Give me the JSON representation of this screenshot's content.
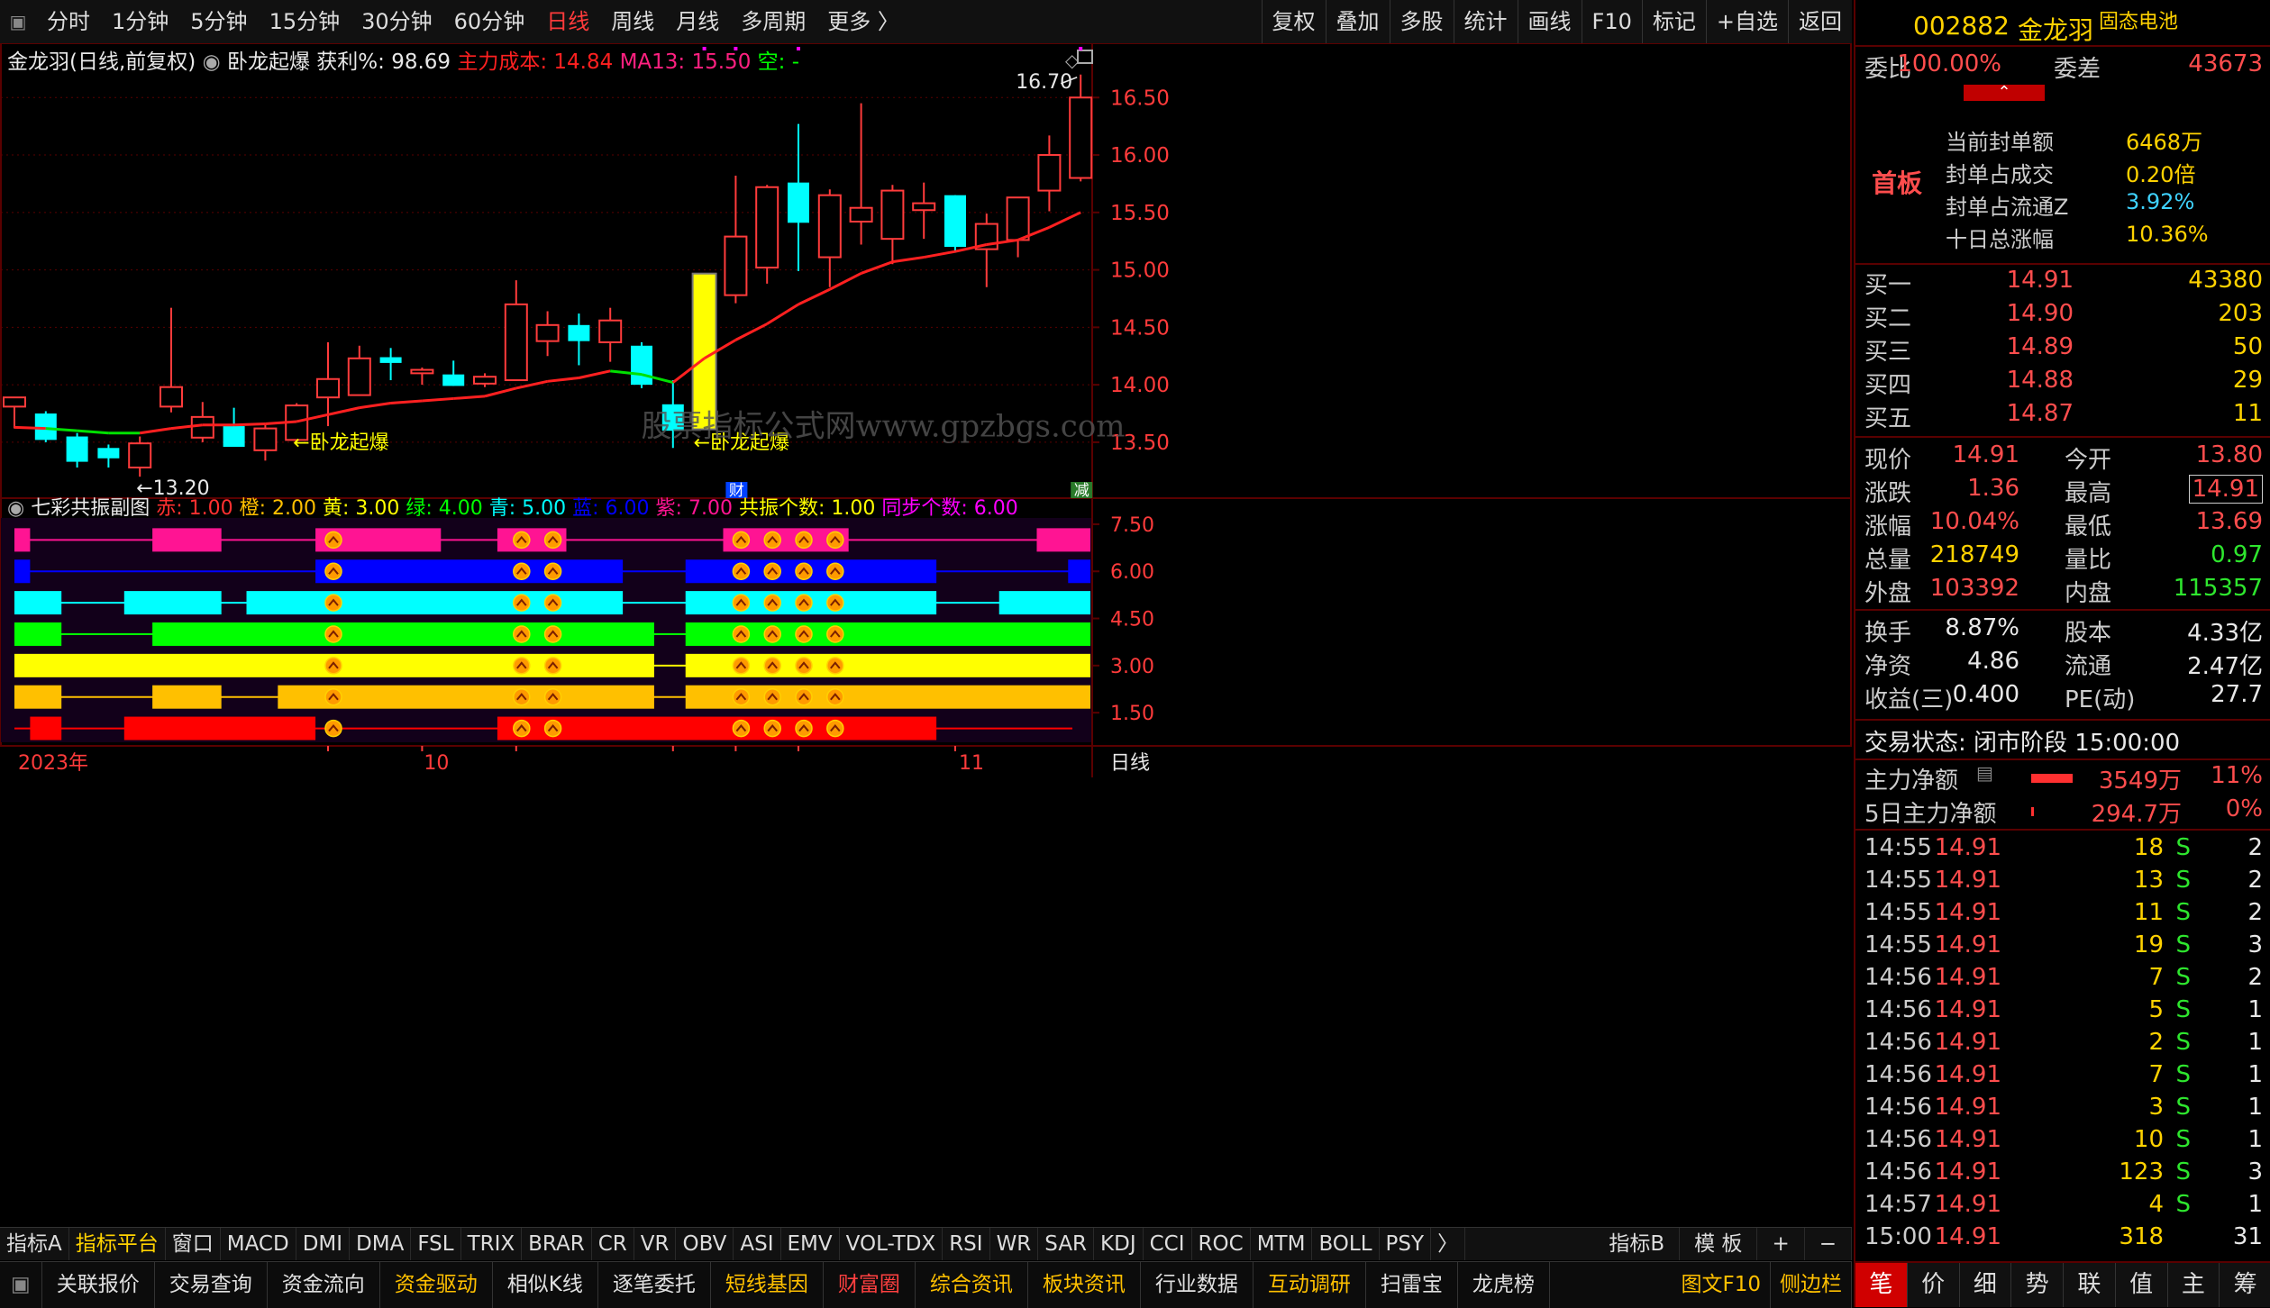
{
  "toolbar": {
    "periods": [
      "分时",
      "1分钟",
      "5分钟",
      "15分钟",
      "30分钟",
      "60分钟",
      "日线",
      "周线",
      "月线",
      "多周期",
      "更多 〉"
    ],
    "active_period": "日线",
    "right": [
      "复权",
      "叠加",
      "多股",
      "统计",
      "画线",
      "F10",
      "标记",
      "+自选",
      "返回"
    ]
  },
  "chart_header": {
    "name": "金龙羽(日线,前复权)",
    "indicator": "卧龙起爆",
    "profit_label": "获利%: 98.69",
    "cost_label": "主力成本: 14.84",
    "ma_label": "MA13: 15.50",
    "kong_label": "空: -"
  },
  "annotations": {
    "high_label": "16.70",
    "low_label": "←13.20",
    "signal1": "←卧龙起爆",
    "signal2": "←卧龙起爆",
    "watermark": "股票指标公式网www.gpzbgs.com",
    "cai_badge": "财",
    "jian_badge": "减"
  },
  "sub_header": {
    "name": "七彩共振副图",
    "items": [
      {
        "text": "赤: 1.00",
        "color": "#ff3030"
      },
      {
        "text": "橙: 2.00",
        "color": "#ffc000"
      },
      {
        "text": "黄: 3.00",
        "color": "#ffff00"
      },
      {
        "text": "绿: 4.00",
        "color": "#00ff00"
      },
      {
        "text": "青: 5.00",
        "color": "#00ffff"
      },
      {
        "text": "蓝: 6.00",
        "color": "#0000ff"
      },
      {
        "text": "紫: 7.00",
        "color": "#ff1493"
      },
      {
        "text": "共振个数: 1.00",
        "color": "#ffff00"
      },
      {
        "text": "同步个数: 6.00",
        "color": "#ff00ff"
      }
    ]
  },
  "time_axis": {
    "year": "2023年",
    "m10": "10",
    "m11": "11",
    "period": "日线"
  },
  "chart_data": [
    {
      "type": "candlestick",
      "title": "金龙羽(日线,前复权)",
      "ylim": [
        13.17,
        16.8
      ],
      "yticks": [
        13.5,
        14.0,
        14.5,
        15.0,
        15.5,
        16.0,
        16.5
      ],
      "ytick_labels": [
        "13.50",
        "14.00",
        "14.50",
        "15.00",
        "15.50",
        "16.00",
        "16.50"
      ],
      "candles": [
        {
          "o": 13.81,
          "h": 13.88,
          "l": 13.62,
          "c": 13.89
        },
        {
          "o": 13.75,
          "h": 13.77,
          "l": 13.5,
          "c": 13.52
        },
        {
          "o": 13.55,
          "h": 13.58,
          "l": 13.28,
          "c": 13.33
        },
        {
          "o": 13.45,
          "h": 13.48,
          "l": 13.28,
          "c": 13.36
        },
        {
          "o": 13.28,
          "h": 13.55,
          "l": 13.2,
          "c": 13.49
        },
        {
          "o": 13.81,
          "h": 14.67,
          "l": 13.76,
          "c": 13.98
        },
        {
          "o": 13.54,
          "h": 13.85,
          "l": 13.5,
          "c": 13.72
        },
        {
          "o": 13.64,
          "h": 13.8,
          "l": 13.47,
          "c": 13.46
        },
        {
          "o": 13.43,
          "h": 13.65,
          "l": 13.34,
          "c": 13.62
        },
        {
          "o": 13.52,
          "h": 13.84,
          "l": 13.5,
          "c": 13.82
        },
        {
          "o": 13.89,
          "h": 14.37,
          "l": 13.64,
          "c": 14.05
        },
        {
          "o": 13.91,
          "h": 14.34,
          "l": 13.91,
          "c": 14.23
        },
        {
          "o": 14.24,
          "h": 14.32,
          "l": 14.04,
          "c": 14.19
        },
        {
          "o": 14.1,
          "h": 14.15,
          "l": 14.0,
          "c": 14.13
        },
        {
          "o": 14.09,
          "h": 14.21,
          "l": 13.99,
          "c": 13.99
        },
        {
          "o": 14.01,
          "h": 14.1,
          "l": 13.98,
          "c": 14.07
        },
        {
          "o": 14.04,
          "h": 14.91,
          "l": 14.04,
          "c": 14.7
        },
        {
          "o": 14.38,
          "h": 14.64,
          "l": 14.25,
          "c": 14.52
        },
        {
          "o": 14.52,
          "h": 14.62,
          "l": 14.17,
          "c": 14.38
        },
        {
          "o": 14.37,
          "h": 14.67,
          "l": 14.2,
          "c": 14.56
        },
        {
          "o": 14.34,
          "h": 14.37,
          "l": 13.97,
          "c": 14.0
        },
        {
          "o": 13.83,
          "h": 14.04,
          "l": 13.45,
          "c": 13.6
        },
        {
          "o": 13.62,
          "h": 14.96,
          "l": 13.62,
          "c": 14.96
        },
        {
          "o": 14.78,
          "h": 15.82,
          "l": 14.71,
          "c": 15.29
        },
        {
          "o": 15.02,
          "h": 15.74,
          "l": 14.88,
          "c": 15.72
        },
        {
          "o": 15.76,
          "h": 16.27,
          "l": 14.99,
          "c": 15.41
        },
        {
          "o": 15.11,
          "h": 15.7,
          "l": 14.85,
          "c": 15.65
        },
        {
          "o": 15.42,
          "h": 16.45,
          "l": 15.22,
          "c": 15.54
        },
        {
          "o": 15.27,
          "h": 15.74,
          "l": 15.05,
          "c": 15.69
        },
        {
          "o": 15.52,
          "h": 15.76,
          "l": 15.27,
          "c": 15.58
        },
        {
          "o": 15.65,
          "h": 15.65,
          "l": 15.15,
          "c": 15.2
        },
        {
          "o": 15.18,
          "h": 15.49,
          "l": 14.85,
          "c": 15.4
        },
        {
          "o": 15.26,
          "h": 15.6,
          "l": 15.11,
          "c": 15.63
        },
        {
          "o": 15.69,
          "h": 16.17,
          "l": 15.51,
          "c": 16.0
        },
        {
          "o": 15.8,
          "h": 16.7,
          "l": 15.77,
          "c": 16.5
        }
      ],
      "ma13": [
        13.63,
        13.62,
        13.6,
        13.58,
        13.58,
        13.62,
        13.65,
        13.65,
        13.66,
        13.68,
        13.74,
        13.8,
        13.84,
        13.86,
        13.88,
        13.9,
        13.97,
        14.03,
        14.06,
        14.12,
        14.09,
        14.02,
        14.23,
        14.39,
        14.53,
        14.7,
        14.83,
        14.97,
        15.07,
        15.11,
        15.16,
        15.22,
        15.26,
        15.37,
        15.5
      ],
      "ma13_green_ranges": [
        [
          1,
          4
        ],
        [
          19,
          21
        ]
      ],
      "signal_bars": [
        22
      ]
    },
    {
      "type": "resonance_bands",
      "title": "七彩共振副图",
      "ylim": [
        0.5,
        7.9
      ],
      "yticks": [
        1.5,
        3.0,
        4.5,
        6.0,
        7.5
      ],
      "ytick_labels": [
        "1.50",
        "3.00",
        "4.50",
        "6.00",
        "7.50"
      ],
      "bands": [
        {
          "name": "紫",
          "level": 7,
          "color": "#ff1493",
          "segments": [
            [
              0,
              0.5
            ],
            [
              4.4,
              6.6
            ],
            [
              9.6,
              13.6
            ],
            [
              15.4,
              17.6
            ],
            [
              22.6,
              26.6
            ],
            [
              32.6,
              34.6
            ]
          ]
        },
        {
          "name": "蓝",
          "level": 6,
          "color": "#0000ff",
          "segments": [
            [
              0,
              0.5
            ],
            [
              9.6,
              19.4
            ],
            [
              21.4,
              29.4
            ],
            [
              33.6,
              34.6
            ]
          ]
        },
        {
          "name": "青",
          "level": 5,
          "color": "#00ffff",
          "segments": [
            [
              0,
              1.5
            ],
            [
              3.5,
              6.6
            ],
            [
              7.4,
              19.4
            ],
            [
              21.4,
              29.4
            ],
            [
              31.4,
              34.6
            ]
          ]
        },
        {
          "name": "绿",
          "level": 4,
          "color": "#00ff00",
          "segments": [
            [
              0,
              1.5
            ],
            [
              4.4,
              20.4
            ],
            [
              21.4,
              34.6
            ]
          ]
        },
        {
          "name": "黄",
          "level": 3,
          "color": "#ffff00",
          "segments": [
            [
              0,
              20.4
            ],
            [
              21.4,
              34.6
            ]
          ]
        },
        {
          "name": "橙",
          "level": 2,
          "color": "#ffc000",
          "segments": [
            [
              0,
              1.5
            ],
            [
              4.4,
              6.6
            ],
            [
              8.4,
              20.4
            ],
            [
              21.4,
              34.6
            ]
          ]
        },
        {
          "name": "赤",
          "level": 1,
          "color": "#ff0000",
          "segments": [
            [
              0.5,
              1.5
            ],
            [
              3.5,
              9.6
            ],
            [
              15.4,
              29.4
            ]
          ]
        }
      ],
      "markers": [
        10,
        16,
        17,
        23,
        24,
        25,
        26
      ],
      "marker_rows": [
        [
          7,
          6,
          5,
          4,
          3,
          2,
          1
        ],
        [
          7,
          6,
          5,
          4,
          3,
          2,
          1
        ],
        [
          7,
          6,
          5,
          4,
          3,
          2,
          1
        ],
        [
          7,
          6,
          5,
          4,
          3,
          2,
          1
        ],
        [
          7,
          6,
          5,
          4,
          3,
          2,
          1
        ],
        [
          7,
          6,
          5,
          4,
          3,
          2,
          1
        ],
        [
          7,
          6,
          5,
          4,
          3,
          2,
          1
        ]
      ]
    }
  ],
  "panel": {
    "code": "002882",
    "name": "金龙羽",
    "tag": "固态电池",
    "weibi_label": "委比",
    "weibi": "100.00%",
    "weicha_label": "委差",
    "weicha": "43673",
    "board": "首板",
    "seal": [
      {
        "label": "当前封单额",
        "value": "6468万"
      },
      {
        "label": "封单占成交",
        "value": "0.20倍"
      },
      {
        "label": "封单占流通Z",
        "value": "3.92%"
      },
      {
        "label": "十日总涨幅",
        "value": "10.36%"
      }
    ],
    "bids": [
      {
        "label": "买一",
        "price": "14.91",
        "vol": "43380"
      },
      {
        "label": "买二",
        "price": "14.90",
        "vol": "203"
      },
      {
        "label": "买三",
        "price": "14.89",
        "vol": "50"
      },
      {
        "label": "买四",
        "price": "14.88",
        "vol": "29"
      },
      {
        "label": "买五",
        "price": "14.87",
        "vol": "11"
      }
    ],
    "quote": [
      {
        "l1": "现价",
        "v1": "14.91",
        "c1": "red",
        "l2": "今开",
        "v2": "13.80",
        "c2": "red"
      },
      {
        "l1": "涨跌",
        "v1": "1.36",
        "c1": "red",
        "l2": "最高",
        "v2": "14.91",
        "c2": "red"
      },
      {
        "l1": "涨幅",
        "v1": "10.04%",
        "c1": "red",
        "l2": "最低",
        "v2": "13.69",
        "c2": "red"
      },
      {
        "l1": "总量",
        "v1": "218749",
        "c1": "yellow",
        "l2": "量比",
        "v2": "0.97",
        "c2": "green"
      },
      {
        "l1": "外盘",
        "v1": "103392",
        "c1": "red",
        "l2": "内盘",
        "v2": "115357",
        "c2": "green"
      }
    ],
    "fin": [
      {
        "l1": "换手",
        "v1": "8.87%",
        "l2": "股本",
        "v2": "4.33亿"
      },
      {
        "l1": "净资",
        "v1": "4.86",
        "l2": "流通",
        "v2": "2.47亿"
      },
      {
        "l1": "收益(三)",
        "v1": "0.400",
        "l2": "PE(动)",
        "v2": "27.7"
      }
    ],
    "status": "交易状态: 闭市阶段 15:00:00",
    "flow": [
      {
        "label": "主力净额",
        "value": "3549万",
        "pct": "11%"
      },
      {
        "label": "5日主力净额",
        "value": "294.7万",
        "pct": "0%"
      }
    ],
    "ticks": [
      {
        "t": "14:55",
        "p": "14.91",
        "v": "18",
        "s": "S",
        "n": "2"
      },
      {
        "t": "14:55",
        "p": "14.91",
        "v": "13",
        "s": "S",
        "n": "2"
      },
      {
        "t": "14:55",
        "p": "14.91",
        "v": "11",
        "s": "S",
        "n": "2"
      },
      {
        "t": "14:55",
        "p": "14.91",
        "v": "19",
        "s": "S",
        "n": "3"
      },
      {
        "t": "14:56",
        "p": "14.91",
        "v": "7",
        "s": "S",
        "n": "2"
      },
      {
        "t": "14:56",
        "p": "14.91",
        "v": "5",
        "s": "S",
        "n": "1"
      },
      {
        "t": "14:56",
        "p": "14.91",
        "v": "2",
        "s": "S",
        "n": "1"
      },
      {
        "t": "14:56",
        "p": "14.91",
        "v": "7",
        "s": "S",
        "n": "1"
      },
      {
        "t": "14:56",
        "p": "14.91",
        "v": "3",
        "s": "S",
        "n": "1"
      },
      {
        "t": "14:56",
        "p": "14.91",
        "v": "10",
        "s": "S",
        "n": "1"
      },
      {
        "t": "14:56",
        "p": "14.91",
        "v": "123",
        "s": "S",
        "n": "3"
      },
      {
        "t": "14:57",
        "p": "14.91",
        "v": "4",
        "s": "S",
        "n": "1"
      },
      {
        "t": "15:00",
        "p": "14.91",
        "v": "318",
        "s": "",
        "n": "31"
      }
    ],
    "bottom_tabs": [
      "笔",
      "价",
      "细",
      "势",
      "联",
      "值",
      "主",
      "筹"
    ],
    "bottom_active": "笔"
  },
  "indicator_tabs": [
    "指标A",
    "指标平台",
    "窗口",
    "MACD",
    "DMI",
    "DMA",
    "FSL",
    "TRIX",
    "BRAR",
    "CR",
    "VR",
    "OBV",
    "ASI",
    "EMV",
    "VOL-TDX",
    "RSI",
    "WR",
    "SAR",
    "KDJ",
    "CCI",
    "ROC",
    "MTM",
    "BOLL",
    "PSY",
    "〉"
  ],
  "indicator_active": "指标平台",
  "indicator_right": [
    "指标B",
    "模 板",
    "+",
    "−"
  ],
  "func_tabs": [
    {
      "label": "关联报价",
      "color": "#e0e0e0"
    },
    {
      "label": "交易查询",
      "color": "#e0e0e0"
    },
    {
      "label": "资金流向",
      "color": "#e0e0e0"
    },
    {
      "label": "资金驱动",
      "color": "#ffc000"
    },
    {
      "label": "相似K线",
      "color": "#e0e0e0"
    },
    {
      "label": "逐笔委托",
      "color": "#e0e0e0"
    },
    {
      "label": "短线基因",
      "color": "#ffc000"
    },
    {
      "label": "财富圈",
      "color": "#ff4040"
    },
    {
      "label": "综合资讯",
      "color": "#ffc000"
    },
    {
      "label": "板块资讯",
      "color": "#ffc000"
    },
    {
      "label": "行业数据",
      "color": "#e0e0e0"
    },
    {
      "label": "互动调研",
      "color": "#ffc000"
    },
    {
      "label": "扫雷宝",
      "color": "#e0e0e0"
    },
    {
      "label": "龙虎榜",
      "color": "#e0e0e0"
    }
  ],
  "func_right": [
    "图文F10",
    "侧边栏"
  ],
  "colors": {
    "up": "#ff3b3b",
    "down": "#00ffff",
    "ma": "#ff2020",
    "ma_flat": "#00e000",
    "signal": "#ffff00",
    "grid": "#5a0000"
  }
}
